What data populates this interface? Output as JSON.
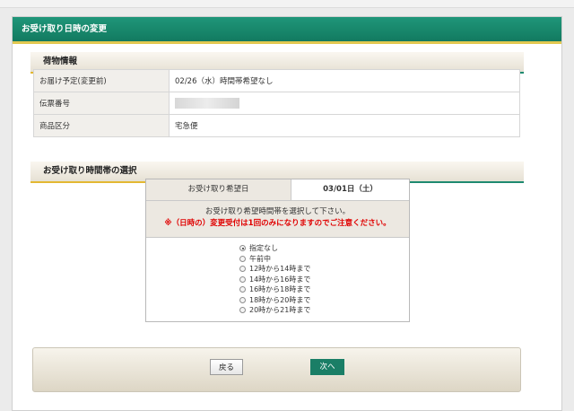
{
  "header": {
    "title": "お受け取り日時の変更"
  },
  "sections": {
    "package_info": "荷物情報",
    "time_selection": "お受け取り時間帯の選択"
  },
  "package_table": [
    {
      "label": "お届け予定(変更前)",
      "value": "02/26（水）時間帯希望なし"
    },
    {
      "label": "伝票番号",
      "value": ""
    },
    {
      "label": "商品区分",
      "value": "宅急便"
    }
  ],
  "time_box": {
    "date_label": "お受け取り希望日",
    "date_value": "03/01日（土）",
    "instruction": "お受け取り希望時間帯を選択して下さい。",
    "warning": "※（日時の）変更受付は1回のみになりますのでご注意ください。",
    "options": [
      {
        "label": "指定なし",
        "selected": true
      },
      {
        "label": "午前中",
        "selected": false
      },
      {
        "label": "12時から14時まで",
        "selected": false
      },
      {
        "label": "14時から16時まで",
        "selected": false
      },
      {
        "label": "16時から18時まで",
        "selected": false
      },
      {
        "label": "18時から20時まで",
        "selected": false
      },
      {
        "label": "20時から21時まで",
        "selected": false
      }
    ]
  },
  "footer": {
    "back_label": "戻る",
    "next_label": "次へ"
  },
  "colors": {
    "header_green": "#1a8a6e",
    "accent_gold": "#e3b832",
    "warning_red": "#e00000"
  }
}
